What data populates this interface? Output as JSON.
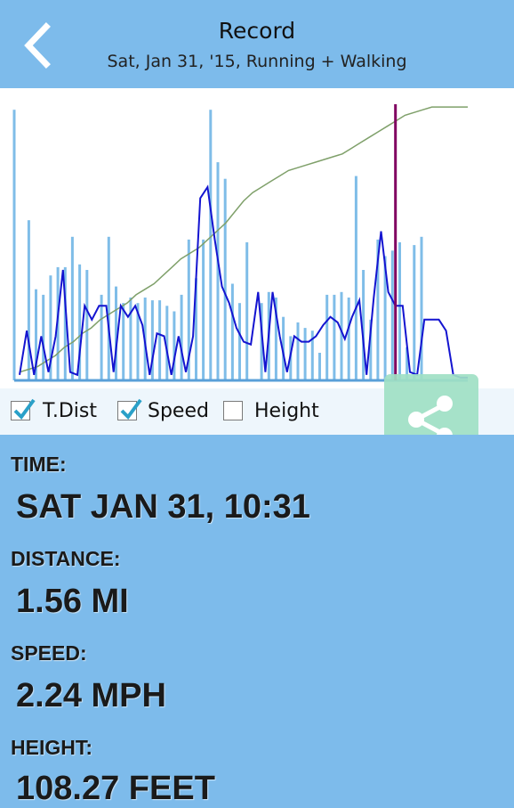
{
  "header": {
    "title": "Record",
    "subtitle": "Sat, Jan 31, '15, Running + Walking"
  },
  "legend": {
    "items": [
      {
        "label": "T.Dist",
        "checked": true
      },
      {
        "label": "Speed",
        "checked": true
      },
      {
        "label": "Height",
        "checked": false
      }
    ]
  },
  "info": {
    "time_label": "TIME:",
    "time_value": "SAT JAN 31, 10:31",
    "distance_label": "DISTANCE:",
    "distance_value": "1.56 MI",
    "speed_label": "SPEED:",
    "speed_value": "2.24 MPH",
    "height_label": "HEIGHT:",
    "height_value": "108.27 FEET"
  },
  "icons": [
    "back-arrow-icon",
    "share-icon",
    "check-icon"
  ],
  "colors": {
    "background": "#7dbbeb",
    "bars": "#7fbde8",
    "speed_line": "#1414d0",
    "distance_line": "#7fa06a",
    "cursor": "#800060",
    "share_button": "#a0e0c4"
  },
  "chart_data": {
    "type": "line",
    "title": "",
    "xlabel": "",
    "ylabel": "",
    "ylim": [
      0,
      1
    ],
    "cursor_index": 52,
    "bars": [
      0.98,
      0,
      0.58,
      0.33,
      0.31,
      0.38,
      0.41,
      0.41,
      0.52,
      0.42,
      0.4,
      0,
      0.31,
      0.52,
      0.34,
      0.28,
      0.3,
      0.28,
      0.3,
      0.29,
      0.29,
      0.27,
      0.25,
      0.31,
      0.51,
      0.37,
      0.51,
      0.98,
      0.79,
      0.73,
      0.35,
      0.28,
      0.5,
      0,
      0.28,
      0.32,
      0.3,
      0.23,
      0.16,
      0.21,
      0.19,
      0.18,
      0.1,
      0.31,
      0.31,
      0.32,
      0.3,
      0.74,
      0.4,
      0.22,
      0.51,
      0.45,
      0.47,
      0.5,
      0.12,
      0.49,
      0.52
    ],
    "speed": [
      0.02,
      0.18,
      0.02,
      0.16,
      0.03,
      0.16,
      0.4,
      0.03,
      0.02,
      0.27,
      0.22,
      0.27,
      0.27,
      0.03,
      0.27,
      0.23,
      0.27,
      0.2,
      0.02,
      0.17,
      0.16,
      0.02,
      0.16,
      0.03,
      0.16,
      0.66,
      0.7,
      0.51,
      0.34,
      0.28,
      0.19,
      0.14,
      0.13,
      0.32,
      0.03,
      0.32,
      0.16,
      0.03,
      0.16,
      0.14,
      0.14,
      0.16,
      0.2,
      0.23,
      0.21,
      0.15,
      0.23,
      0.29,
      0.02,
      0.3,
      0.54,
      0.32,
      0.27,
      0.27,
      0.03,
      0.02,
      0.22,
      0.22,
      0.22,
      0.18,
      0.02,
      0.01,
      0.01
    ],
    "total_distance": [
      0.03,
      0.04,
      0.05,
      0.07,
      0.09,
      0.12,
      0.14,
      0.17,
      0.19,
      0.22,
      0.24,
      0.26,
      0.28,
      0.31,
      0.33,
      0.35,
      0.38,
      0.41,
      0.44,
      0.46,
      0.48,
      0.51,
      0.54,
      0.57,
      0.61,
      0.65,
      0.68,
      0.7,
      0.72,
      0.74,
      0.76,
      0.77,
      0.78,
      0.79,
      0.8,
      0.81,
      0.82,
      0.84,
      0.86,
      0.88,
      0.9,
      0.92,
      0.94,
      0.96,
      0.97,
      0.98,
      0.99,
      0.99,
      0.99,
      0.99,
      0.99
    ]
  }
}
